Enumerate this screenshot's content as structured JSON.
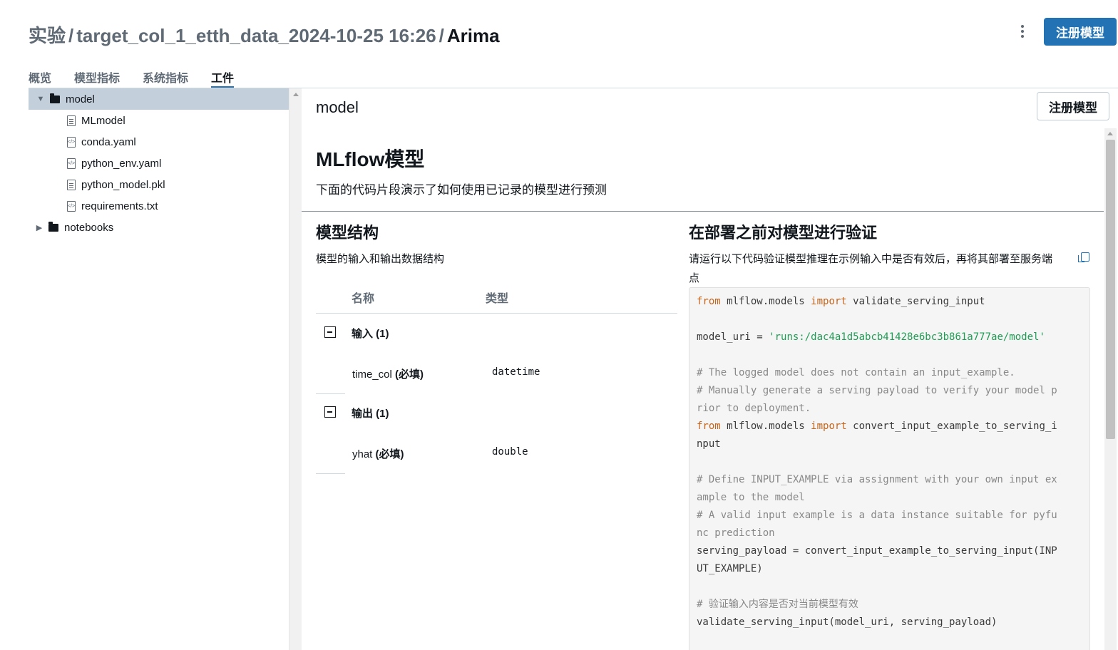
{
  "header": {
    "breadcrumb": [
      "实验",
      "target_col_1_etth_data_2024-10-25 16:26"
    ],
    "separator": "/",
    "current": "Arima",
    "register_button": "注册模型"
  },
  "tabs": [
    {
      "label": "概览",
      "active": false
    },
    {
      "label": "模型指标",
      "active": false
    },
    {
      "label": "系统指标",
      "active": false
    },
    {
      "label": "工件",
      "active": true
    }
  ],
  "tree": {
    "items": [
      {
        "label": "model",
        "type": "folder",
        "expanded": true,
        "selected": true,
        "caret": "▼"
      },
      {
        "label": "MLmodel",
        "type": "file-text"
      },
      {
        "label": "conda.yaml",
        "type": "file-code"
      },
      {
        "label": "python_env.yaml",
        "type": "file-code"
      },
      {
        "label": "python_model.pkl",
        "type": "file-text"
      },
      {
        "label": "requirements.txt",
        "type": "file-code"
      },
      {
        "label": "notebooks",
        "type": "folder",
        "expanded": false,
        "caret": "▶"
      }
    ]
  },
  "panel": {
    "title": "model",
    "register_button": "注册模型",
    "mlflow_title": "MLflow模型",
    "mlflow_desc": "下面的代码片段演示了如何使用已记录的模型进行预测",
    "schema": {
      "title": "模型结构",
      "desc": "模型的输入和输出数据结构",
      "col_name": "名称",
      "col_type": "类型",
      "inputs_label": "输入 (1)",
      "outputs_label": "输出 (1)",
      "input_field": {
        "name": "time_col",
        "required": "(必填)",
        "type": "datetime"
      },
      "output_field": {
        "name": "yhat",
        "required": "(必填)",
        "type": "double"
      }
    },
    "validate": {
      "title": "在部署之前对模型进行验证",
      "desc_line1": "请运行以下代码验证模型推理在示例输入中是否有效后，再将其部署至服务端",
      "desc_line2": "点"
    },
    "code": [
      {
        "k": "from",
        "t": " mlflow.models ",
        "k2": "import",
        "t2": " validate_serving_input"
      },
      {
        "t": ""
      },
      {
        "t": "model_uri = ",
        "s": "'runs:/dac4a1d5abcb41428e6bc3b861a777ae/model'"
      },
      {
        "t": ""
      },
      {
        "c": "# The logged model does not contain an input_example."
      },
      {
        "c": "# Manually generate a serving payload to verify your model p"
      },
      {
        "c": "rior to deployment."
      },
      {
        "k": "from",
        "t": " mlflow.models ",
        "k2": "import",
        "t2": " convert_input_example_to_serving_i"
      },
      {
        "t": "nput"
      },
      {
        "t": ""
      },
      {
        "c": "# Define INPUT_EXAMPLE via assignment with your own input ex"
      },
      {
        "c": "ample to the model"
      },
      {
        "c": "# A valid input example is a data instance suitable for pyfu"
      },
      {
        "c": "nc prediction"
      },
      {
        "t": "serving_payload = convert_input_example_to_serving_input(INP"
      },
      {
        "t": "UT_EXAMPLE)"
      },
      {
        "t": ""
      },
      {
        "c": "# 验证输入内容是否对当前模型有效"
      },
      {
        "t": "validate_serving_input(model_uri, serving_payload)"
      }
    ]
  }
}
